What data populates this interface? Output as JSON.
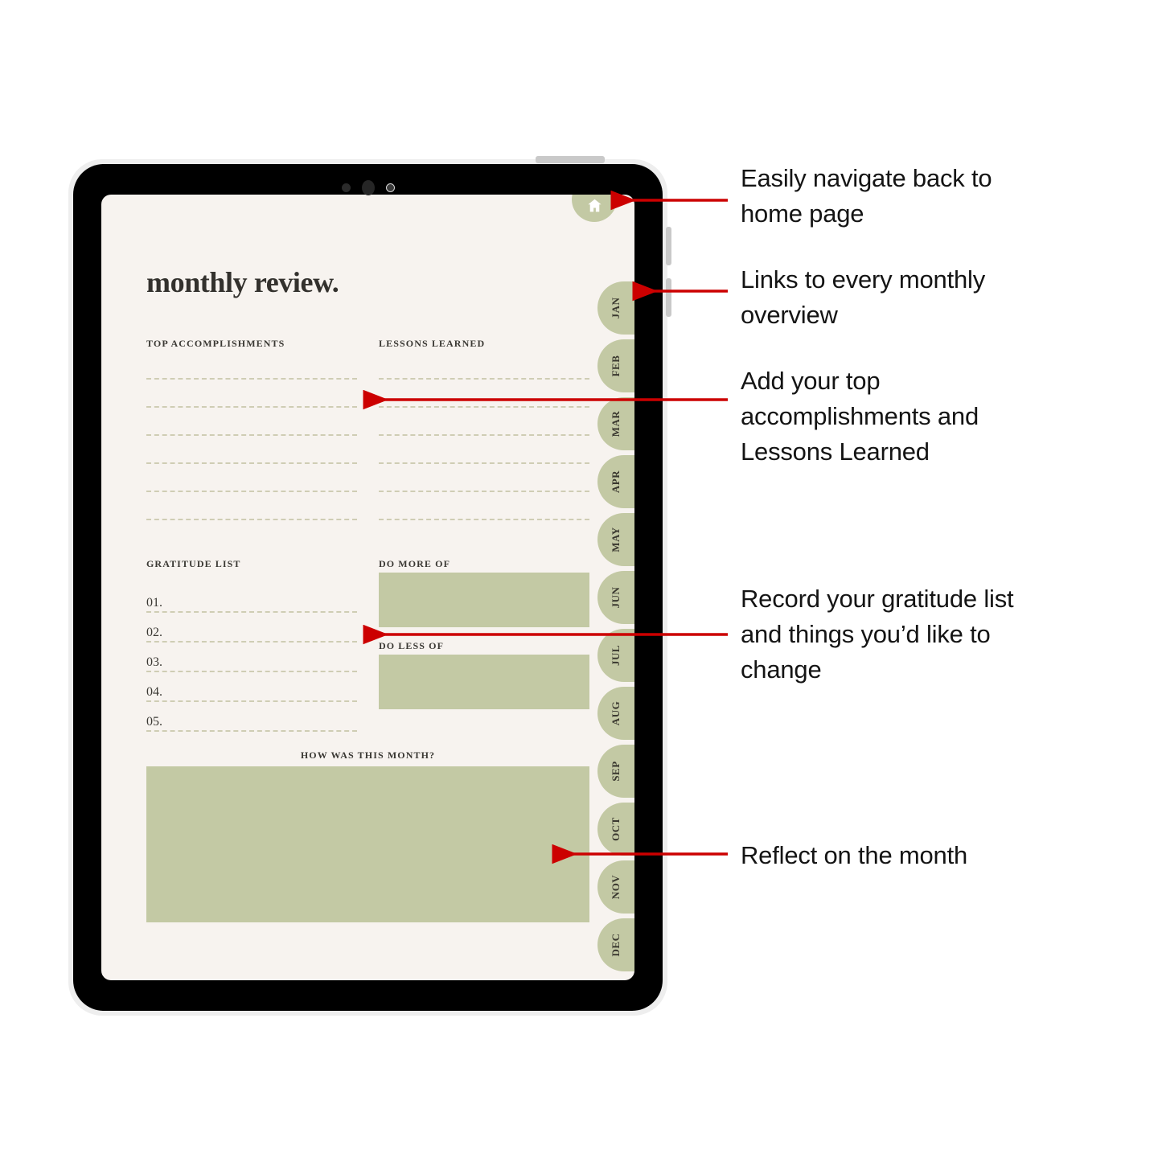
{
  "device": {
    "type": "tablet",
    "bezel_color": "#000000",
    "frame_color": "#eeeeee"
  },
  "screen": {
    "background_color": "#f7f3ef",
    "accent_color": "#c3c9a4",
    "text_color": "#33312d"
  },
  "planner": {
    "title": "monthly review.",
    "home_button": {
      "icon": "home-icon",
      "label": "Home"
    },
    "month_tabs": [
      "JAN",
      "FEB",
      "MAR",
      "APR",
      "MAY",
      "JUN",
      "JUL",
      "AUG",
      "SEP",
      "OCT",
      "NOV",
      "DEC"
    ],
    "sections": {
      "accomplishments": {
        "heading": "TOP ACCOMPLISHMENTS",
        "line_count": 6
      },
      "lessons": {
        "heading": "LESSONS LEARNED",
        "line_count": 6
      },
      "gratitude": {
        "heading": "GRATITUDE LIST",
        "items": [
          "01.",
          "02.",
          "03.",
          "04.",
          "05."
        ]
      },
      "do_more": {
        "heading": "DO MORE OF",
        "value": ""
      },
      "do_less": {
        "heading": "DO LESS OF",
        "value": ""
      },
      "reflection": {
        "heading": "HOW WAS THIS MONTH?",
        "value": ""
      }
    }
  },
  "annotations": {
    "arrow_color": "#cc0000",
    "items": [
      {
        "id": "anno-1",
        "text": "Easily navigate back to home page"
      },
      {
        "id": "anno-2",
        "text": "Links to every monthly overview"
      },
      {
        "id": "anno-3",
        "text": "Add your top accomplishments and Lessons Learned"
      },
      {
        "id": "anno-4",
        "text": "Record your gratitude list and things you’d like to change"
      },
      {
        "id": "anno-5",
        "text": "Reflect on the month"
      }
    ]
  }
}
